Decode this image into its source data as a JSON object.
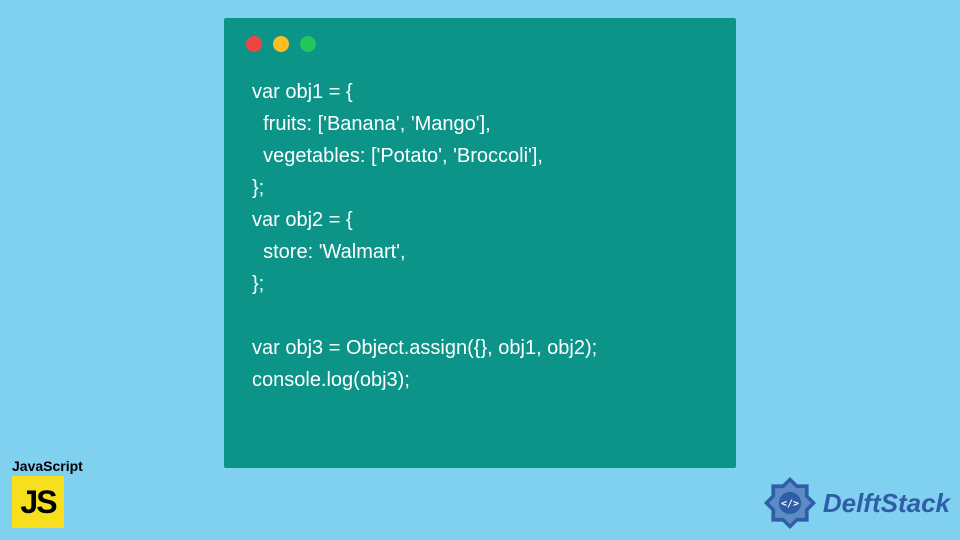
{
  "code": {
    "line1": "var obj1 = {",
    "line2": "  fruits: ['Banana', 'Mango'],",
    "line3": "  vegetables: ['Potato', 'Broccoli'],",
    "line4": "};",
    "line5": "var obj2 = {",
    "line6": "  store: 'Walmart',",
    "line7": "};",
    "line8": "",
    "line9": "var obj3 = Object.assign({}, obj1, obj2);",
    "line10": "console.log(obj3);"
  },
  "badges": {
    "js_label": "JavaScript",
    "js_logo_text": "JS",
    "delft_text": "DelftStack"
  },
  "colors": {
    "background": "#80d0f0",
    "code_bg": "#0d9488",
    "code_text": "#ffffff",
    "js_yellow": "#f7df1e",
    "delft_blue": "#2f5da8"
  }
}
